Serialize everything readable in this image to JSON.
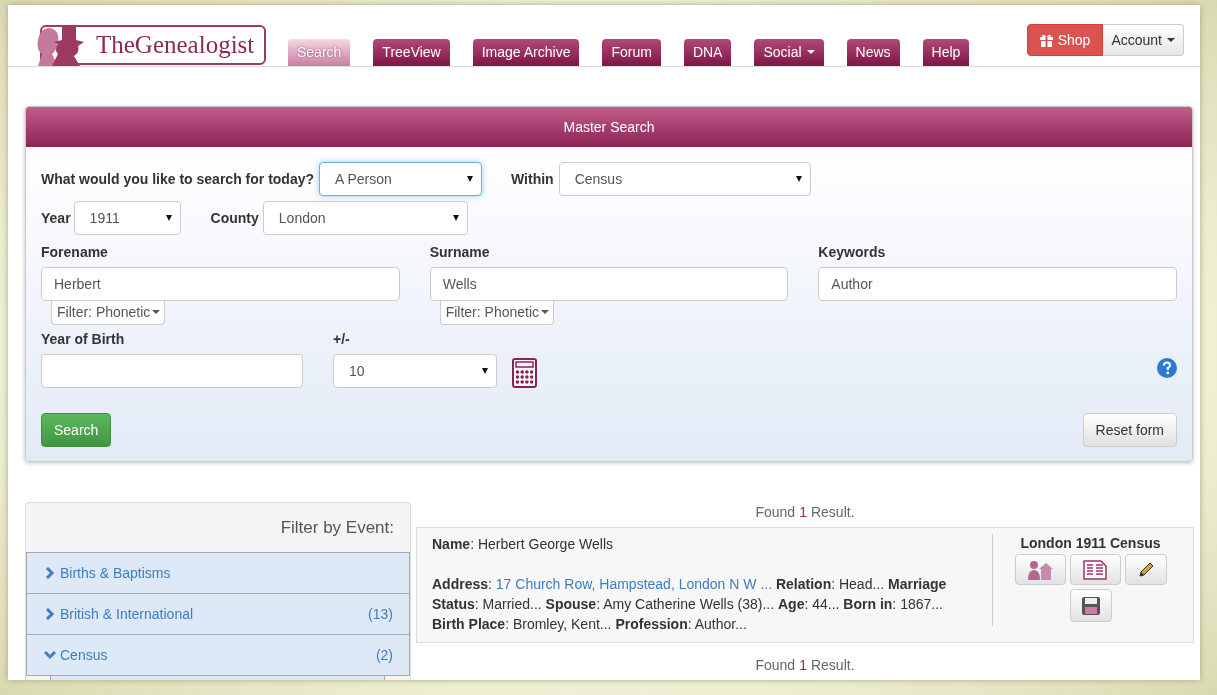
{
  "logo": {
    "text": "TheGenealogist"
  },
  "nav": [
    {
      "label": "Search",
      "selected": true,
      "dropdown": false
    },
    {
      "label": "TreeView",
      "selected": false,
      "dropdown": false
    },
    {
      "label": "Image Archive",
      "selected": false,
      "dropdown": false
    },
    {
      "label": "Forum",
      "selected": false,
      "dropdown": false
    },
    {
      "label": "DNA",
      "selected": false,
      "dropdown": false
    },
    {
      "label": "Social",
      "selected": false,
      "dropdown": true
    },
    {
      "label": "News",
      "selected": false,
      "dropdown": false
    },
    {
      "label": "Help",
      "selected": false,
      "dropdown": false
    }
  ],
  "shop_button": "Shop",
  "account_button": "Account",
  "search_panel": {
    "title": "Master Search",
    "what_label": "What would you like to search for today?",
    "what_value": "A Person",
    "within_label": "Within",
    "within_value": "Census",
    "year_label": "Year",
    "year_value": "1911",
    "county_label": "County",
    "county_value": "London",
    "name_fields": [
      {
        "label": "Forename",
        "value": "Herbert",
        "filter": "Filter: Phonetic"
      },
      {
        "label": "Surname",
        "value": "Wells",
        "filter": "Filter: Phonetic"
      },
      {
        "label": "Keywords",
        "value": "Author"
      }
    ],
    "birth_label": "Year of Birth",
    "range_label": "+/-",
    "range_value": "10",
    "search_button": "Search",
    "reset_button": "Reset form"
  },
  "filter_sidebar": {
    "title": "Filter by Event:",
    "items": [
      {
        "label": "Births & Baptisms",
        "expanded": false
      },
      {
        "label": "British & International",
        "count": "(13)",
        "expanded": false
      },
      {
        "label": "Census",
        "count": "(2)",
        "expanded": true
      }
    ]
  },
  "results": {
    "found_top": {
      "before": "Found",
      "count": "1",
      "after": "Result."
    },
    "found_bottom": {
      "before": "Found",
      "count": "1",
      "after": "Result."
    },
    "records": [
      {
        "name_label": "**Name**:",
        "name": "Herbert George Wells",
        "fields": [
          {
            "label": "**Address**:",
            "value": "17 Church Row, Hampstead, London N W ...",
            "kind": "link"
          },
          {
            "label": "**Relation**:",
            "value": "Head...",
            "kind": "text"
          },
          {
            "label": "**Marriage Status**:",
            "value": "Married...",
            "kind": "text"
          },
          {
            "label": "**Spouse**:",
            "value": "Amy Catherine Wells (38)...",
            "kind": "text"
          },
          {
            "label": "**Age**:",
            "value": "44...",
            "kind": "text"
          },
          {
            "label": "**Born in**:",
            "value": "1867...",
            "kind": "text"
          },
          {
            "label": "**Birth Place**:",
            "value": "Bromley, Kent...",
            "kind": "text"
          },
          {
            "label": "**Profession**:",
            "value": "Author...",
            "kind": "text"
          }
        ],
        "source": "London 1911 Census"
      }
    ]
  }
}
